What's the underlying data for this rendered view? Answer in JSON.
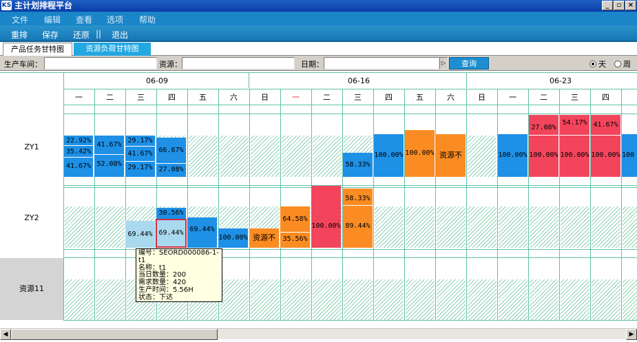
{
  "window": {
    "title": "主计划排程平台",
    "icon_text": "KS",
    "btn_min": "_",
    "btn_max": "▫",
    "btn_close": "×"
  },
  "menu": [
    "文件",
    "编辑",
    "查看",
    "选项",
    "帮助"
  ],
  "toolbar": [
    "重排",
    "保存",
    "还原",
    "||",
    "退出"
  ],
  "tabs": [
    "产品任务甘特图",
    "资源负荷甘特图"
  ],
  "filters": {
    "workshop_label": "生产车间：",
    "resource_label": "资源：",
    "date_label": "日期：",
    "query_label": "查询",
    "day_label": "天",
    "week_label": "周",
    "selected_view": "天"
  },
  "calendar": {
    "weeks": [
      "06-09",
      "06-16",
      "06-23"
    ],
    "days": [
      "一",
      "二",
      "三",
      "四",
      "五",
      "六",
      "日",
      "一",
      "二",
      "三",
      "四",
      "五",
      "六",
      "日",
      "一",
      "二",
      "三",
      "四"
    ],
    "highlight_day_color": "#e0202f"
  },
  "rows": [
    {
      "label": "ZY1",
      "blocks": [
        {
          "lines": [
            "22.92%",
            "35.42%",
            "41.67%"
          ]
        },
        {
          "lines": [
            "41.67%",
            "52.08%"
          ]
        },
        {
          "lines": [
            "29.17%",
            "41.67%",
            "29.17%"
          ]
        },
        {
          "lines": [
            "66.67%",
            "27.08%"
          ]
        },
        {
          "lines": [
            "58.33%"
          ]
        },
        {
          "lines": [
            "100.00%"
          ]
        },
        {
          "lines": [
            "100.00%"
          ]
        },
        {
          "lines": [
            "资源不"
          ]
        },
        {
          "lines": [
            "100.00%"
          ]
        },
        {
          "lines": [
            "27.08%",
            "100.00%"
          ]
        },
        {
          "lines": [
            "54.17%",
            "100.00%"
          ]
        },
        {
          "lines": [
            "41.67%",
            "100.00%"
          ]
        },
        {
          "lines": [
            "100"
          ]
        }
      ]
    },
    {
      "label": "ZY2",
      "blocks": [
        {
          "lines": [
            "69.44%"
          ]
        },
        {
          "lines": [
            "30.56%",
            "69.44%"
          ]
        },
        {
          "lines": [
            "69.44%"
          ]
        },
        {
          "lines": [
            "100.00%"
          ]
        },
        {
          "lines": [
            "资源不"
          ]
        },
        {
          "lines": [
            "64.58%",
            "35.56%"
          ]
        },
        {
          "lines": [
            "100.00%"
          ]
        },
        {
          "lines": [
            "58.33%",
            "89.44%"
          ]
        }
      ]
    },
    {
      "label": "资源11",
      "blocks": []
    }
  ],
  "tooltip": {
    "code": "编号：SEORD000086-1-t1",
    "name": "名称：t1",
    "day_qty": "当日数量：200",
    "need_qty": "需求数量：420",
    "prod_time": "生产时间：5.56H",
    "status": "状态：下达"
  },
  "colors": {
    "blue": "#1e90e6",
    "orange": "#fb8c23",
    "red": "#f2455c",
    "light_blue": "#a9d9ee",
    "grid": "#5fc0a8"
  }
}
